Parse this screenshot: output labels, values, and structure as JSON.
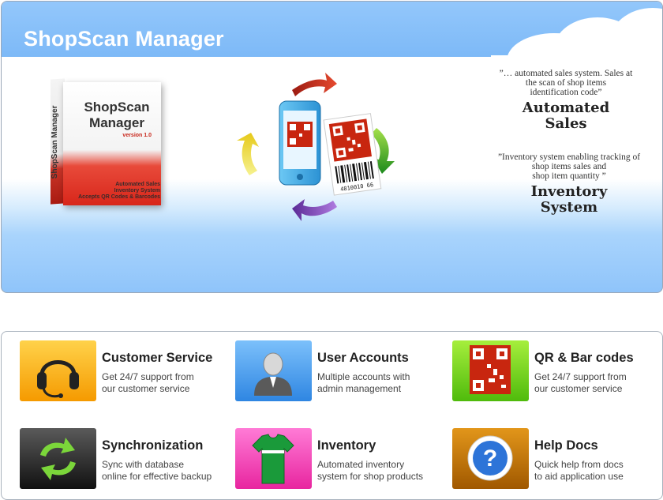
{
  "banner": {
    "title": "ShopScan Manager"
  },
  "product_box": {
    "side_text": "ShopScan Manager",
    "title": "ShopScan\nManager",
    "version": "version 1.0",
    "caption": "Automated Sales\nInventory System\nAccepts QR Codes & Barcodes"
  },
  "barcode_digits": "4810010 66",
  "quotes": [
    {
      "text": "”… automated sales system. Sales at\nthe scan of shop items\nidentification code”",
      "title": "Automated\nSales"
    },
    {
      "text": "”Inventory system enabling tracking of\nshop items sales and\nshop item quantity ”",
      "title": "Inventory\nSystem"
    }
  ],
  "features": [
    {
      "title": "Customer Service",
      "desc": "Get 24/7 support from\nour customer service",
      "icon": "headset-icon",
      "color": "#f7a100"
    },
    {
      "title": "User Accounts",
      "desc": "Multiple accounts with\nadmin management",
      "icon": "user-icon",
      "color": "#4a9ff0"
    },
    {
      "title": "QR & Bar codes",
      "desc": "Get 24/7 support from\nour customer service",
      "icon": "qr-code-icon",
      "color": "#5fcf14"
    },
    {
      "title": "Synchronization",
      "desc": "Sync with database\nonline for effective backup",
      "icon": "sync-icon",
      "color": "#2a2a2a"
    },
    {
      "title": "Inventory",
      "desc": "Automated inventory\nsystem for shop products",
      "icon": "shirt-icon",
      "color": "#ee35b4"
    },
    {
      "title": "Help Docs",
      "desc": "Quick help from docs\nto aid application use",
      "icon": "help-icon",
      "color": "#b76a00"
    }
  ]
}
